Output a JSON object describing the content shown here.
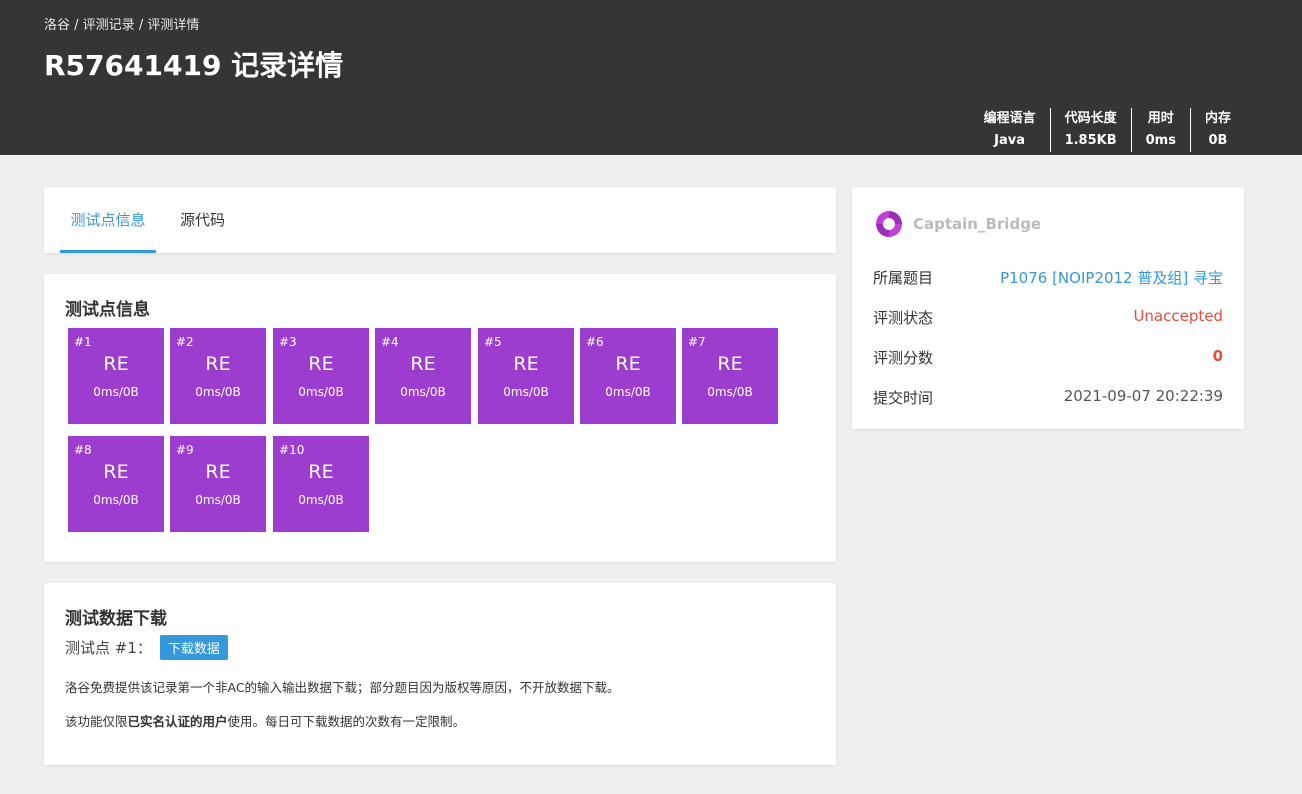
{
  "header": {
    "breadcrumb": [
      "洛谷",
      "评测记录",
      "评测详情"
    ],
    "title": "R57641419 记录详情",
    "stats": [
      {
        "label": "编程语言",
        "value": "Java"
      },
      {
        "label": "代码长度",
        "value": "1.85KB"
      },
      {
        "label": "用时",
        "value": "0ms"
      },
      {
        "label": "内存",
        "value": "0B"
      }
    ]
  },
  "tabs": [
    {
      "label": "测试点信息",
      "active": true
    },
    {
      "label": "源代码",
      "active": false
    }
  ],
  "testcases": {
    "title": "测试点信息",
    "status_color": "#9d3dcf",
    "items": [
      {
        "num": "#1",
        "status": "RE",
        "detail": "0ms/0B"
      },
      {
        "num": "#2",
        "status": "RE",
        "detail": "0ms/0B"
      },
      {
        "num": "#3",
        "status": "RE",
        "detail": "0ms/0B"
      },
      {
        "num": "#4",
        "status": "RE",
        "detail": "0ms/0B"
      },
      {
        "num": "#5",
        "status": "RE",
        "detail": "0ms/0B"
      },
      {
        "num": "#6",
        "status": "RE",
        "detail": "0ms/0B"
      },
      {
        "num": "#7",
        "status": "RE",
        "detail": "0ms/0B"
      },
      {
        "num": "#8",
        "status": "RE",
        "detail": "0ms/0B"
      },
      {
        "num": "#9",
        "status": "RE",
        "detail": "0ms/0B"
      },
      {
        "num": "#10",
        "status": "RE",
        "detail": "0ms/0B"
      }
    ]
  },
  "download": {
    "title": "测试数据下载",
    "testcase_label": "测试点 #1：",
    "button": "下载数据",
    "note1": "洛谷免费提供该记录第一个非AC的输入输出数据下载；部分题目因为版权等原因，不开放数据下载。",
    "note2_pre": "该功能仅限",
    "note2_bold": "已实名认证的用户",
    "note2_post": "使用。每日可下载数据的次数有一定限制。"
  },
  "sidebar": {
    "username": "Captain_Bridge",
    "avatar_icon": "user-avatar-logo-icon",
    "rows": [
      {
        "key": "所属题目",
        "value": "P1076 [NOIP2012 普及组] 寻宝"
      },
      {
        "key": "评测状态",
        "value": "Unaccepted"
      },
      {
        "key": "评测分数",
        "value": "0"
      },
      {
        "key": "提交时间",
        "value": "2021-09-07 20:22:39"
      }
    ]
  },
  "colors": {
    "accent": "#3498db",
    "header_bg": "#343536",
    "error": "#e74c3c"
  }
}
